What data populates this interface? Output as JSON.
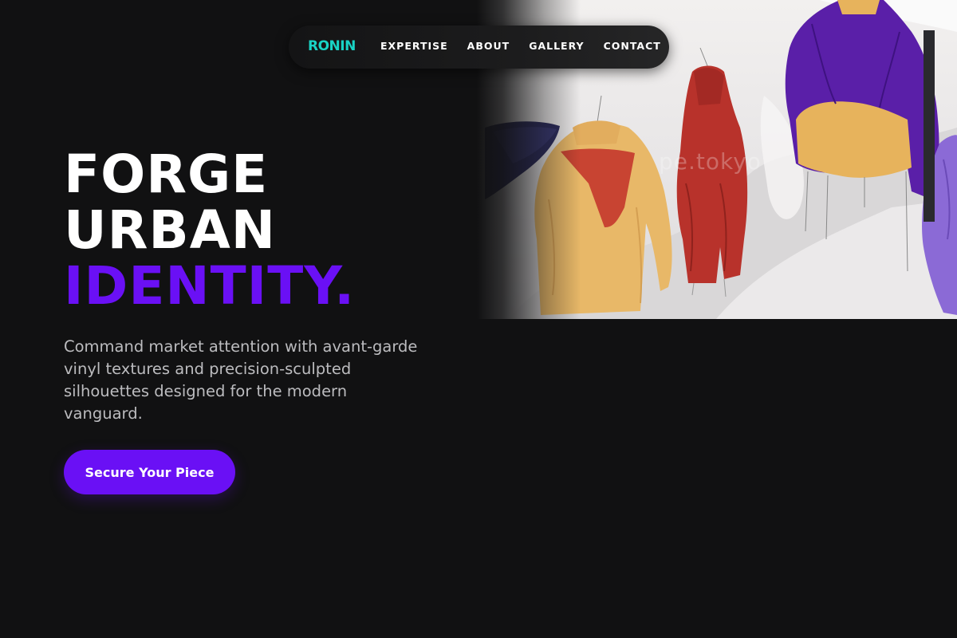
{
  "brand": {
    "logo_text": "RONIN",
    "accent_color": "#19d3c5"
  },
  "nav": {
    "links": [
      {
        "label": "EXPERTISE"
      },
      {
        "label": "ABOUT"
      },
      {
        "label": "GALLERY"
      },
      {
        "label": "CONTACT"
      }
    ]
  },
  "hero": {
    "headline_line1": "FORGE",
    "headline_line2": "URBAN",
    "headline_line3": "IDENTITY.",
    "headline_accent_color": "#6a10f5",
    "subtext": "Command market attention with avant-garde vinyl textures and precision-sculpted silhouettes designed for the modern vanguard.",
    "cta_label": "Secure Your Piece",
    "image_watermark": "pe.tokyo"
  },
  "colors": {
    "background": "#111112",
    "primary": "#6a10f5",
    "text": "#ffffff",
    "muted_text": "#bcbcbf"
  }
}
